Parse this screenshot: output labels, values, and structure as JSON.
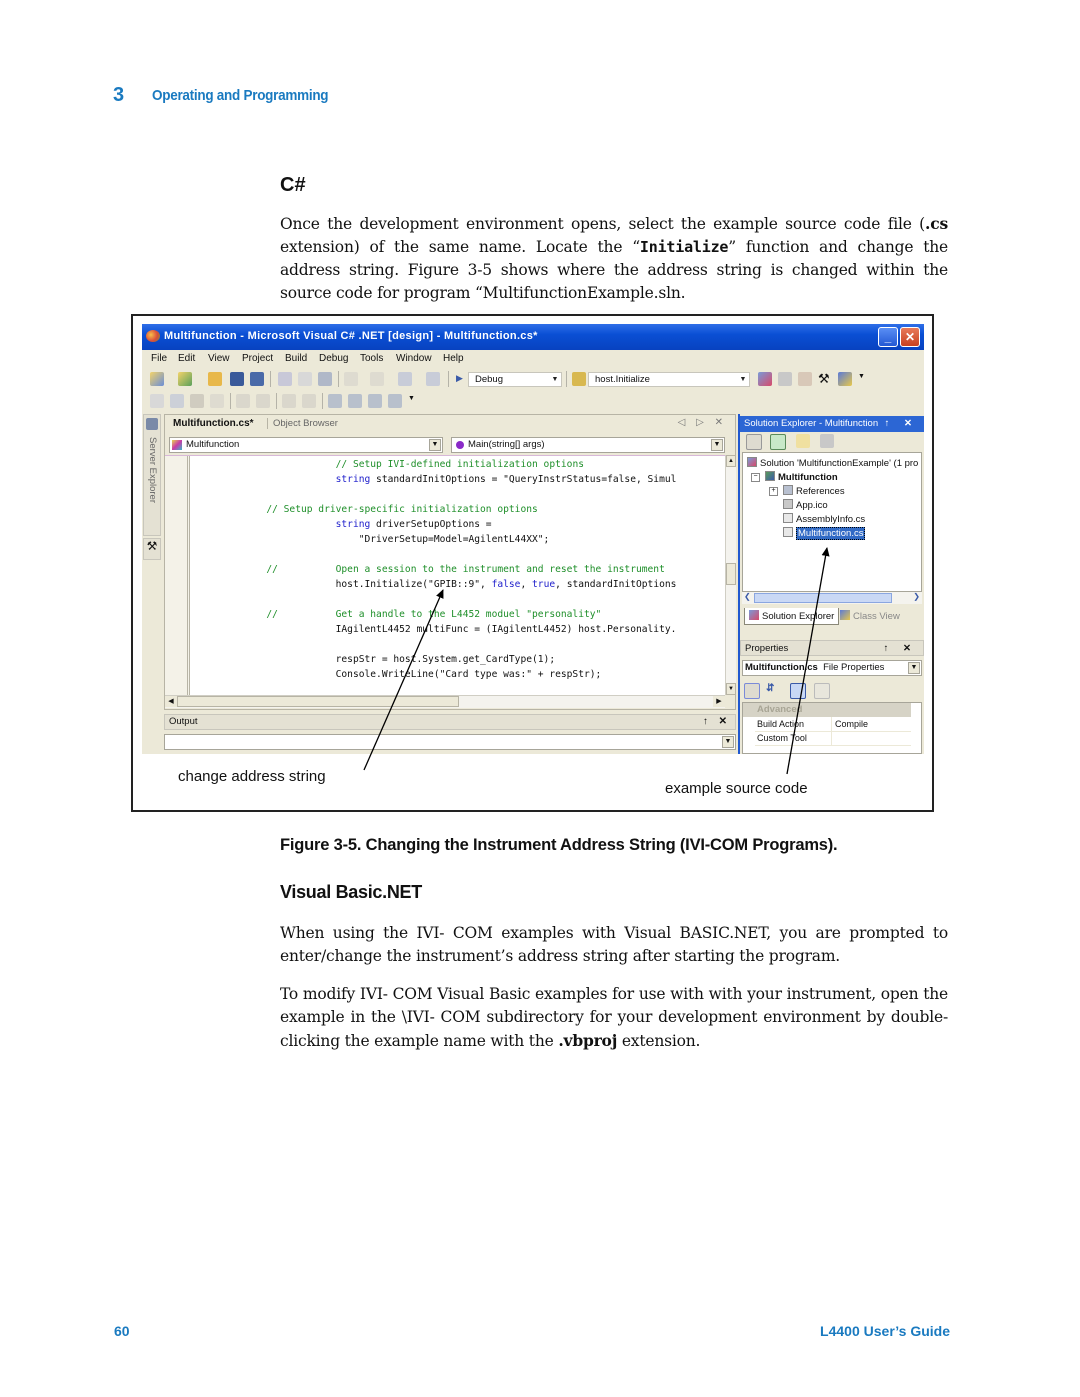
{
  "header": {
    "chapter_number": "3",
    "chapter_title": "Operating and Programming"
  },
  "section": {
    "title": "C#",
    "paragraph": {
      "part1": "Once the development environment opens, select the example source code file (",
      "bold1": ".cs",
      "part2": " extension) of the same name. Locate the “",
      "code1": "Initialize",
      "part3": "” function and change the address string. Figure 3-5 shows where the address string is changed within the source code for program “MultifunctionExample.sln."
    }
  },
  "figure": {
    "caption": "Figure 3-5. Changing the Instrument Address String (IVI-COM Programs).",
    "callouts": {
      "left": "change address string",
      "right": "example source code"
    },
    "ide": {
      "title": "Multifunction - Microsoft Visual C# .NET [design] - Multifunction.cs*",
      "window_buttons": {
        "minimize": "_",
        "maximize": "□",
        "close": "✕"
      },
      "menu": [
        "File",
        "Edit",
        "View",
        "Project",
        "Build",
        "Debug",
        "Tools",
        "Window",
        "Help"
      ],
      "toolbar": {
        "config": "Debug",
        "find": "host.Initialize"
      },
      "left_dock": {
        "server_explorer": "Server Explorer",
        "toolbox_icon": "⚒"
      },
      "editor": {
        "tabs": {
          "active": "Multifunction.cs*",
          "other": "Object Browser"
        },
        "nav": "◁ ▷ ✕",
        "class_combo": "Multifunction",
        "member_combo": "Main(string[] args)",
        "lines": [
          {
            "segments": [
              {
                "t": "                        ",
                "c": ""
              },
              {
                "t": "// Setup IVI-defined initialization options",
                "c": "com"
              }
            ]
          },
          {
            "segments": [
              {
                "t": "                        ",
                "c": ""
              },
              {
                "t": "string",
                "c": "kw"
              },
              {
                "t": " standardInitOptions = \"QueryInstrStatus=false, Simul",
                "c": ""
              }
            ]
          },
          {
            "segments": [
              {
                "t": "",
                "c": ""
              }
            ]
          },
          {
            "segments": [
              {
                "t": "            ",
                "c": ""
              },
              {
                "t": "// Setup driver-specific initialization options",
                "c": "com"
              }
            ]
          },
          {
            "segments": [
              {
                "t": "                        ",
                "c": ""
              },
              {
                "t": "string",
                "c": "kw"
              },
              {
                "t": " driverSetupOptions =",
                "c": ""
              }
            ]
          },
          {
            "segments": [
              {
                "t": "                            \"DriverSetup=Model=AgilentL44XX\";",
                "c": ""
              }
            ]
          },
          {
            "segments": [
              {
                "t": "",
                "c": ""
              }
            ]
          },
          {
            "segments": [
              {
                "t": "            ",
                "c": ""
              },
              {
                "t": "//          Open a session to the instrument and reset the instrument",
                "c": "com"
              }
            ]
          },
          {
            "segments": [
              {
                "t": "                        host.Initialize(\"GPIB::9\", ",
                "c": ""
              },
              {
                "t": "false",
                "c": "kw"
              },
              {
                "t": ", ",
                "c": ""
              },
              {
                "t": "true",
                "c": "kw"
              },
              {
                "t": ", standardInitOptions",
                "c": ""
              }
            ]
          },
          {
            "segments": [
              {
                "t": "",
                "c": ""
              }
            ]
          },
          {
            "segments": [
              {
                "t": "            ",
                "c": ""
              },
              {
                "t": "//          Get a handle to the L4452 moduel \"personality\"",
                "c": "com"
              }
            ]
          },
          {
            "segments": [
              {
                "t": "                        IAgilentL4452 multiFunc = (IAgilentL4452) host.Personality.",
                "c": ""
              }
            ]
          },
          {
            "segments": [
              {
                "t": "",
                "c": ""
              }
            ]
          },
          {
            "segments": [
              {
                "t": "                        respStr = host.System.get_CardType(1);",
                "c": ""
              }
            ]
          },
          {
            "segments": [
              {
                "t": "                        Console.WriteLine(\"Card type was:\" + respStr);",
                "c": ""
              }
            ]
          }
        ]
      },
      "output": {
        "title": "Output",
        "controls": "↑ ✕"
      },
      "solution_explorer": {
        "title": "Solution Explorer - Multifunction",
        "controls": "↑ ✕",
        "tree": [
          {
            "label": "Solution 'MultifunctionExample' (1 pro",
            "level": 0,
            "bold": false,
            "selected": false
          },
          {
            "label": "Multifunction",
            "level": 1,
            "bold": true,
            "selected": false
          },
          {
            "label": "References",
            "level": 2,
            "bold": false,
            "selected": false
          },
          {
            "label": "App.ico",
            "level": 2,
            "bold": false,
            "selected": false
          },
          {
            "label": "AssemblyInfo.cs",
            "level": 2,
            "bold": false,
            "selected": false
          },
          {
            "label": "Multifunction.cs",
            "level": 2,
            "bold": false,
            "selected": true
          }
        ],
        "tabs": {
          "active": "Solution Explorer",
          "other": "Class View"
        }
      },
      "properties": {
        "title": "Properties",
        "controls": "↑ ✕",
        "object": "Multifunction.cs",
        "object_type": "File Properties",
        "category": "Advanced",
        "rows": [
          {
            "key": "Build Action",
            "value": "Compile"
          },
          {
            "key": "Custom Tool",
            "value": ""
          }
        ]
      }
    }
  },
  "vb_section": {
    "title": "Visual Basic.NET",
    "paragraph1": "When using the IVI- COM examples with Visual BASIC.NET, you are prompted to enter/change the instrument’s address string after starting the program.",
    "paragraph2": {
      "part1": "To modify IVI- COM Visual Basic examples for use with with your instrument, open the example in the \\IVI- COM subdirectory for your development environment by double- clicking the example name with the ",
      "bold1": ".vbproj",
      "part2": " extension."
    }
  },
  "footer": {
    "page_number": "60",
    "guide_title": "L4400 User’s Guide"
  }
}
